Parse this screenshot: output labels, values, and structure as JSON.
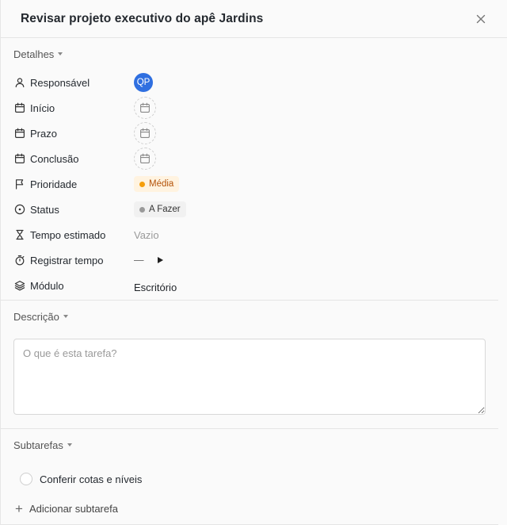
{
  "task": {
    "title": "Revisar projeto executivo do apê Jardins"
  },
  "details": {
    "heading": "Detalhes",
    "assignee": {
      "label": "Responsável",
      "initials": "QP"
    },
    "start": {
      "label": "Início"
    },
    "due": {
      "label": "Prazo"
    },
    "completion": {
      "label": "Conclusão"
    },
    "priority": {
      "label": "Prioridade",
      "value": "Média",
      "color": "#f59e0b"
    },
    "status": {
      "label": "Status",
      "value": "A Fazer",
      "color": "#9a9a9a"
    },
    "estimate": {
      "label": "Tempo estimado",
      "value": "Vazio"
    },
    "time_log": {
      "label": "Registrar tempo",
      "value": "—"
    },
    "module": {
      "label": "Módulo",
      "value": "Escritório"
    }
  },
  "description": {
    "heading": "Descrição",
    "placeholder": "O que é esta tarefa?"
  },
  "subtasks": {
    "heading": "Subtarefas",
    "items": [
      {
        "label": "Conferir cotas e níveis"
      }
    ],
    "add_label": "Adicionar subtarefa"
  },
  "colors": {
    "avatar": "#2f6fe0"
  }
}
